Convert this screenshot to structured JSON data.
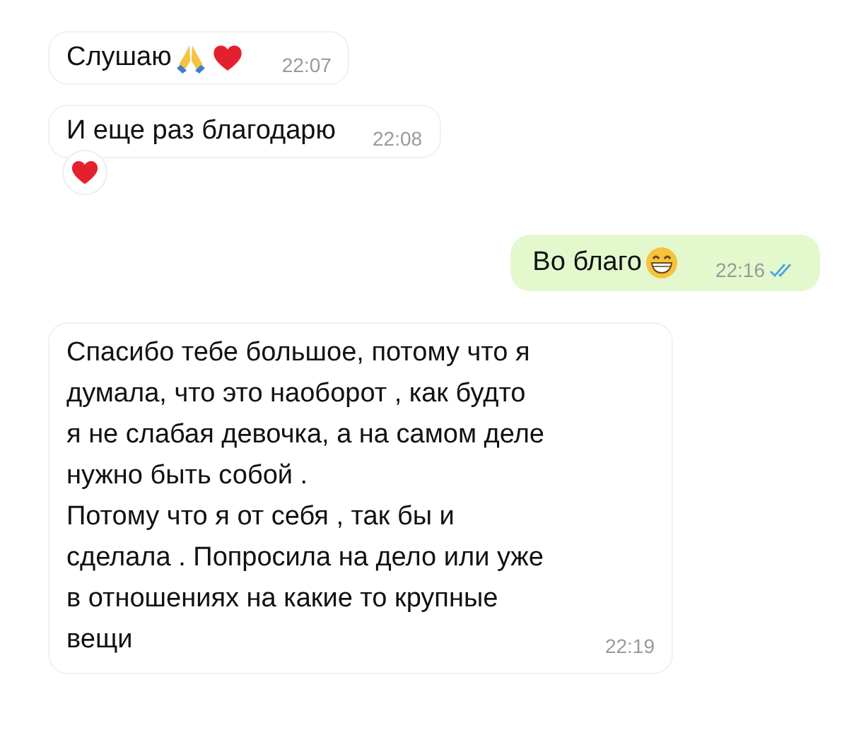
{
  "messages": [
    {
      "kind": "incoming",
      "text": "Слушаю",
      "time": "22:07",
      "reacted": false
    },
    {
      "kind": "incoming",
      "text": "И еще раз благодарю",
      "time": "22:08",
      "reacted": true
    },
    {
      "kind": "outgoing",
      "text": "Во благо",
      "time": "22:16",
      "read": true
    },
    {
      "kind": "incoming",
      "text": "Спасибо тебе большое, потому что я\nдумала, что это наоборот , как будто\nя не слабая девочка, а на самом деле\nнужно быть собой .\nПотому что я от себя , так бы и\nсделала . Попросила на дело или уже\nв отношениях на какие то крупные\nвещи",
      "time": "22:19",
      "reacted": false
    }
  ]
}
